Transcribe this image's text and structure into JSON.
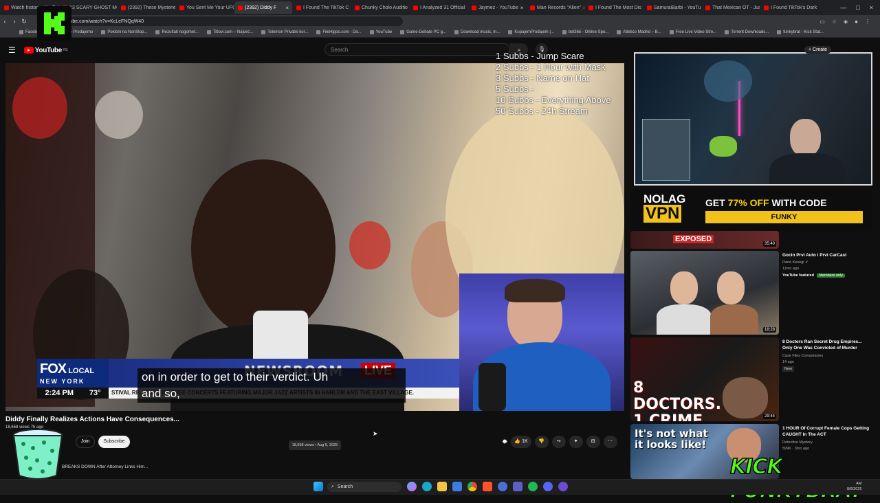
{
  "browser": {
    "tabs": [
      {
        "label": "Watch history - YouTube",
        "active": false
      },
      {
        "label": "13 SCARY GHOST MOMENTS",
        "active": false
      },
      {
        "label": "(2392) These Mysteries",
        "active": false
      },
      {
        "label": "You Sent Me Your UFOs",
        "active": false
      },
      {
        "label": "(2392) Diddy F",
        "active": true
      },
      {
        "label": "I Found The TikTok C",
        "active": false
      },
      {
        "label": "Chunky Cholo Auditio",
        "active": false
      },
      {
        "label": "I Analyzed 31 Official",
        "active": false
      },
      {
        "label": "Jaymez - YouTube",
        "active": false
      },
      {
        "label": "Man Records \"Alien\"",
        "active": false
      },
      {
        "label": "I Found The Most Dis",
        "active": false
      },
      {
        "label": "SamuraiBarbi - YouTu",
        "active": false
      },
      {
        "label": "That Mexican OT - Jus",
        "active": false
      },
      {
        "label": "I Found TikTok's Dark",
        "active": false
      }
    ],
    "url": "youtube.com/watch?v=KcLeFNQqW40",
    "bookmarks": [
      "Facebook",
      "Kupimo Prodajemo",
      "Pokloni na NonStop...",
      "Rezultati nogomet...",
      "Titlovi.com – Najveć...",
      "Telemon Privatni kor...",
      "FileHippo.com - Do...",
      "YouTube",
      "Game-Debate PC g...",
      "Download music, m...",
      "KupujemProdajem |...",
      "bet365 - Online Spo...",
      "Atletico Madrid – B...",
      "Free Live Video Stre...",
      "Torrent Downloads...",
      "funkybrat - Kick Stat..."
    ]
  },
  "youtube": {
    "logo_text": "YouTube",
    "logo_region": "RS",
    "search_placeholder": "Search",
    "create_label": "+ Create"
  },
  "overlay": {
    "sub_goals": [
      "1 Subbs - Jump Scare",
      "2 Subbs - 1 Hour with Mask",
      "3 Subbs - Name on Hat",
      "5 Subbs -",
      "10 Subbs - Everything Above",
      "50 Subbs - 24h Stream"
    ],
    "kick_watermark": "KICK FUNKYBRAT",
    "promo": {
      "brand_top": "NOLAG",
      "brand_bottom": "VPN",
      "offer_prefix": "GET ",
      "offer_highlight": "77% OFF",
      "offer_suffix": " WITH CODE",
      "code": "FUNKY"
    }
  },
  "video": {
    "news_brand_top": "FOX",
    "news_brand_mid": "LOCAL",
    "news_brand_bottom": "NEW YORK",
    "newsroom_text": "NEWSROOM",
    "live_text": "LIVE",
    "time": "2:24 PM",
    "temp": "73°",
    "ticker": "STIVAL RE... DAYS OF FREE CONCERTS FEATURING MAJOR JAZZ ARTISTS IN HARLEM AND THE EAST VILLAGE.",
    "caption_line1": "on in order to get to their verdict. Uh",
    "caption_line2": "and so,",
    "title": "Diddy Finally Realizes Actions Have Consequences...",
    "views_small": "18,658 views 7h ago",
    "join_label": "Join",
    "subscribe_label": "Subscribe",
    "tooltip": "18,658 views • Aug 5, 2025",
    "like_count": "1K",
    "desc_snippet": "BREAKS DOWN After Attorney Links Him..."
  },
  "related": [
    {
      "title": "",
      "channel": "",
      "meta": "",
      "duration": "35:40",
      "badge": "EXPOSED"
    },
    {
      "title": "Gocin Prvi Auto i Prvi CarCast",
      "channel": "Dario Kesegi",
      "meta": "11mo ago",
      "tag1": "YouTube featured",
      "tag2": "Members only",
      "duration": "18:28"
    },
    {
      "title": "8 Doctors Ran Secret Drug Empires... Only One Was Convicted of Murder",
      "channel": "Case Files Conspiracies",
      "meta": "14 ago",
      "tag1": "New",
      "duration": "29:44",
      "thumb_text": "8 DOCTORS. 1 CRIME."
    },
    {
      "title": "1 HOUR Of Corrupt Female Cops Getting CAUGHT In The ACT",
      "channel": "Detective Mystery",
      "meta": "599K · 3mo ago",
      "duration": "",
      "thumb_text": "It's not what it looks like!"
    }
  ],
  "taskbar": {
    "search_label": "Search",
    "clock_time": "AM",
    "clock_date": "8/6/2025"
  }
}
